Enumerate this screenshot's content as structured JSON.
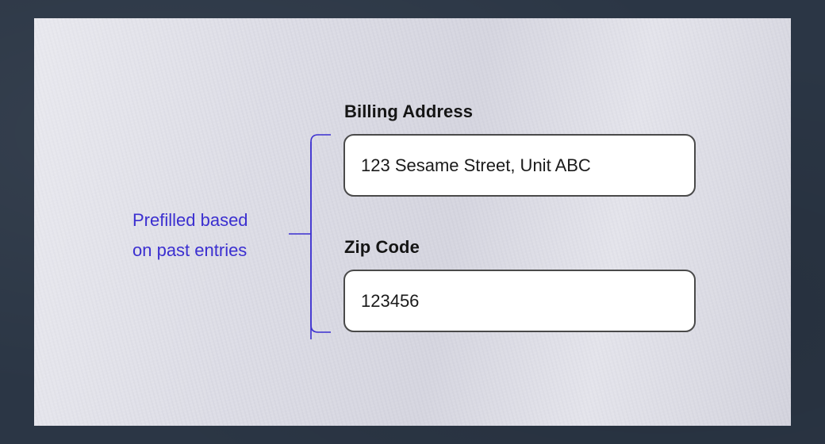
{
  "form": {
    "billing": {
      "label": "Billing Address",
      "value": "123 Sesame Street, Unit ABC"
    },
    "zip": {
      "label": "Zip Code",
      "value": "123456"
    }
  },
  "annotation": {
    "line1": "Prefilled based",
    "line2": "on past entries",
    "color": "#3b2fd0"
  }
}
